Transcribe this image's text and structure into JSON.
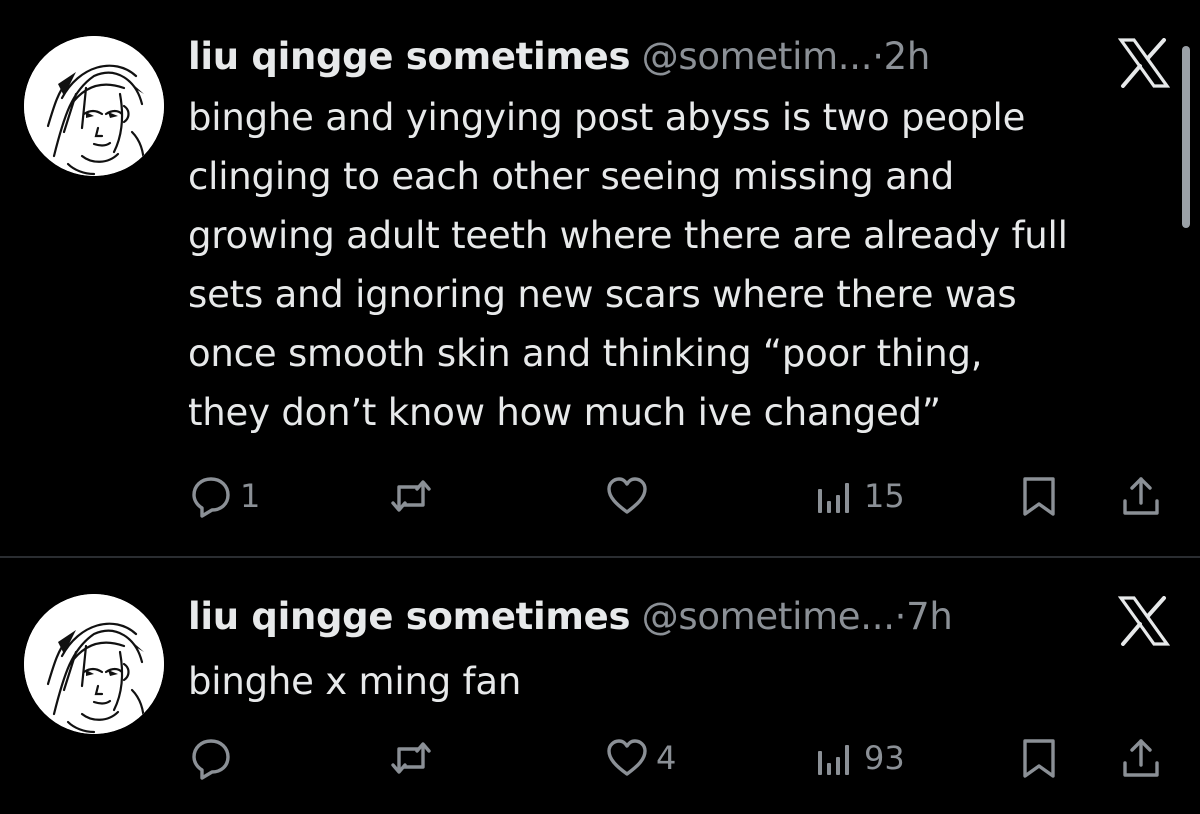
{
  "tweets": [
    {
      "display_name": "liu qingge sometimes",
      "handle": "@sometim...",
      "separator": "·",
      "time": "2h",
      "text_lines": [
        "binghe and yingying post abyss is two people",
        "clinging to each other seeing missing and",
        "growing adult teeth where there are already full",
        "sets and ignoring new scars where there was",
        "once smooth skin and thinking “poor thing,",
        "they don’t know how much ive changed”"
      ],
      "replies": "1",
      "reposts": "",
      "likes": "",
      "views": "15"
    },
    {
      "display_name": "liu qingge sometimes",
      "handle": "@sometime...",
      "separator": "·",
      "time": "7h",
      "text_lines": [
        "binghe x ming fan"
      ],
      "replies": "",
      "reposts": "",
      "likes": "4",
      "views": "93"
    }
  ],
  "icons": {
    "brand": "x-logo-icon",
    "reply": "reply-icon",
    "repost": "repost-icon",
    "like": "heart-icon",
    "views": "views-icon",
    "bookmark": "bookmark-icon",
    "share": "share-icon"
  },
  "colors": {
    "background": "#000000",
    "text": "#e7e9ea",
    "secondary": "#8b9096",
    "divider": "#2a2d31"
  }
}
